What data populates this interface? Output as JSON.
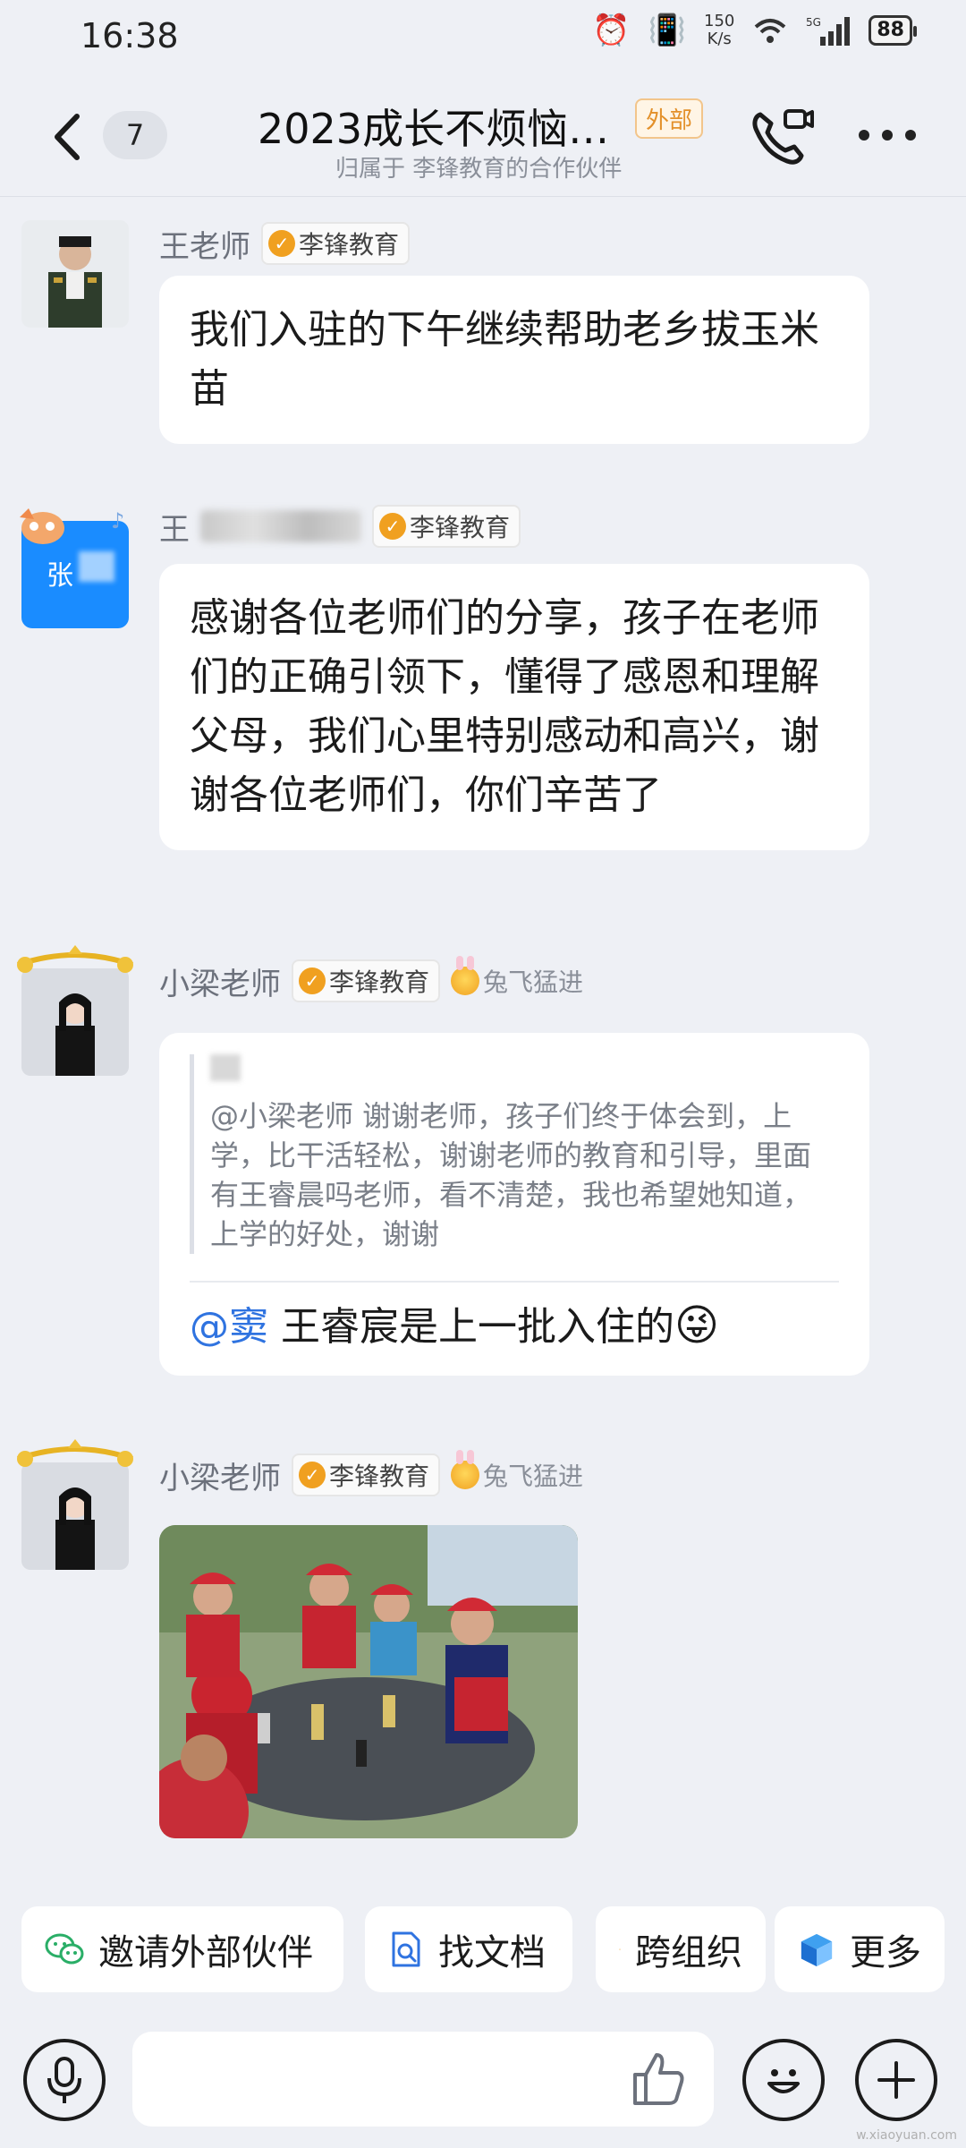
{
  "status_bar": {
    "time": "16:38",
    "net_speed_value": "150",
    "net_speed_unit": "K/s",
    "signal_label": "5G",
    "battery": "88"
  },
  "header": {
    "unread_count": "7",
    "title": "2023成长不烦恼…",
    "external_tag": "外部",
    "subtitle": "归属于 李锋教育的合作伙伴"
  },
  "messages": [
    {
      "sender": "王老师",
      "org": "李锋教育",
      "text": "我们入驻的下午继续帮助老乡拔玉米苗"
    },
    {
      "sender_visible": "王",
      "avatar_text": "张",
      "org": "李锋教育",
      "text": " 感谢各位老师们的分享，孩子在老师们的正确引领下，懂得了感恩和理解父母，我们心里特别感动和高兴，谢谢各位老师们，你们辛苦了"
    },
    {
      "sender": "小梁老师",
      "org": "李锋教育",
      "medal": "兔飞猛进",
      "quote_text": "@小梁老师 谢谢老师，孩子们终于体会到，上学，比干活轻松，谢谢老师的教育和引导，里面有王睿晨吗老师，看不清楚，我也希望她知道，上学的好处，谢谢",
      "mention": "@窦",
      "reply_text": " 王睿宸是上一批入住的"
    },
    {
      "sender": "小梁老师",
      "org": "李锋教育",
      "medal": "兔飞猛进"
    }
  ],
  "chips": [
    {
      "label": "邀请外部伙伴",
      "icon": "wechat-icon"
    },
    {
      "label": "找文档",
      "icon": "doc-search-icon"
    },
    {
      "label": "跨组织",
      "icon": "stamp-icon"
    },
    {
      "label": "更多",
      "icon": "cube-icon"
    }
  ],
  "input": {
    "placeholder": ""
  },
  "watermark": "w.xiaoyuan.com"
}
